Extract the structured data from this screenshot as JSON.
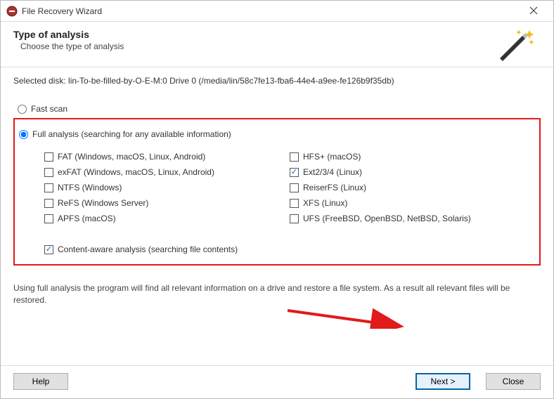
{
  "titlebar": {
    "title": "File Recovery Wizard"
  },
  "header": {
    "heading": "Type of analysis",
    "subheading": "Choose the type of analysis"
  },
  "disk_info": "Selected disk: lin-To-be-filled-by-O-E-M:0 Drive 0 (/media/lin/58c7fe13-fba6-44e4-a9ee-fe126b9f35db)",
  "options": {
    "fast_scan_label": "Fast scan",
    "full_analysis_label": "Full analysis (searching for any available information)",
    "content_aware_label": "Content-aware analysis (searching file contents)"
  },
  "filesystems": {
    "col1": {
      "fat": "FAT (Windows, macOS, Linux, Android)",
      "exfat": "exFAT (Windows, macOS, Linux, Android)",
      "ntfs": "NTFS (Windows)",
      "refs": "ReFS (Windows Server)",
      "apfs": "APFS (macOS)"
    },
    "col2": {
      "hfs": "HFS+ (macOS)",
      "ext": "Ext2/3/4 (Linux)",
      "reiser": "ReiserFS (Linux)",
      "xfs": "XFS (Linux)",
      "ufs": "UFS (FreeBSD, OpenBSD, NetBSD, Solaris)"
    }
  },
  "hint": "Using full analysis the program will find all relevant information on a drive and restore a file system. As a result all relevant files will be restored.",
  "buttons": {
    "help": "Help",
    "next": "Next >",
    "close": "Close"
  }
}
